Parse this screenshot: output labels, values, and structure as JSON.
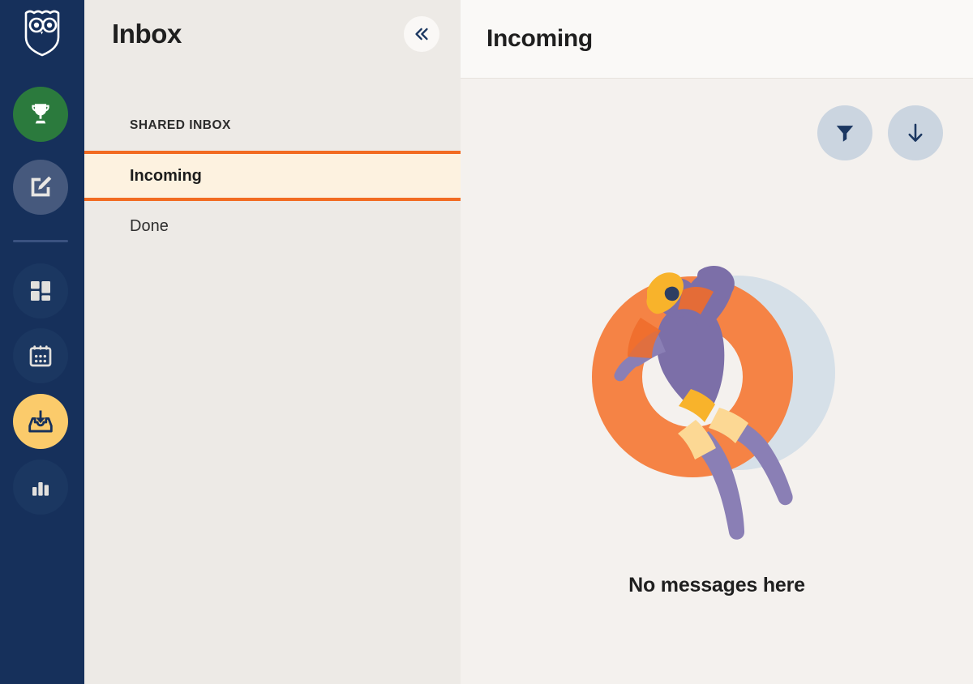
{
  "nav_rail": {
    "logo": {
      "icon": "hootsuite-owl-logo",
      "color": "#FFFFFF"
    },
    "items": [
      {
        "id": "rewards",
        "icon": "trophy-icon",
        "label": "Rewards",
        "bg": "#2B7A3D",
        "fg": "#FFFFFF",
        "active": false
      },
      {
        "id": "compose",
        "icon": "compose-pencil-icon",
        "label": "Compose",
        "bg": "#46597D",
        "fg": "#E8E6E3",
        "active": false
      },
      {
        "id": "streams",
        "icon": "streams-grid-icon",
        "label": "Streams",
        "bg": "#1B3761",
        "fg": "#E2E0DD",
        "active": false
      },
      {
        "id": "planner",
        "icon": "calendar-icon",
        "label": "Planner",
        "bg": "#1B3761",
        "fg": "#E2E0DD",
        "active": false
      },
      {
        "id": "inbox",
        "icon": "inbox-tray-icon",
        "label": "Inbox",
        "bg": "#FBCB6B",
        "fg": "#16305B",
        "active": true
      },
      {
        "id": "analytics",
        "icon": "bar-chart-icon",
        "label": "Analytics",
        "bg": "#1B3761",
        "fg": "#E2E0DD",
        "active": false
      }
    ]
  },
  "list_panel": {
    "title": "Inbox",
    "collapse_button": {
      "icon": "double-chevron-left-icon",
      "label": "Collapse"
    },
    "section_label": "SHARED INBOX",
    "folders": [
      {
        "label": "Incoming",
        "selected": true
      },
      {
        "label": "Done",
        "selected": false
      }
    ]
  },
  "main_panel": {
    "title": "Incoming",
    "actions": [
      {
        "id": "filter",
        "icon": "filter-funnel-icon",
        "label": "Filter"
      },
      {
        "id": "sort",
        "icon": "arrow-down-icon",
        "label": "Sort"
      }
    ],
    "empty_state": {
      "illustration": "person-floating-on-pool-ring-illustration",
      "message": "No messages here"
    }
  },
  "colors": {
    "nav_bg": "#16305B",
    "list_bg": "#EDEAE6",
    "main_bg": "#F4F1EE",
    "header_bg": "#FAF9F7",
    "accent_orange": "#F26B21",
    "selected_row_bg": "#FDF2E0",
    "inbox_active": "#FBCB6B",
    "rewards_green": "#2B7A3D",
    "action_btn_bg": "#CBD5E0",
    "illustration_orange": "#F58345",
    "illustration_purple": "#7C6FA8",
    "illustration_blue": "#D6E0E8",
    "illustration_yellow": "#FBCB6B"
  }
}
